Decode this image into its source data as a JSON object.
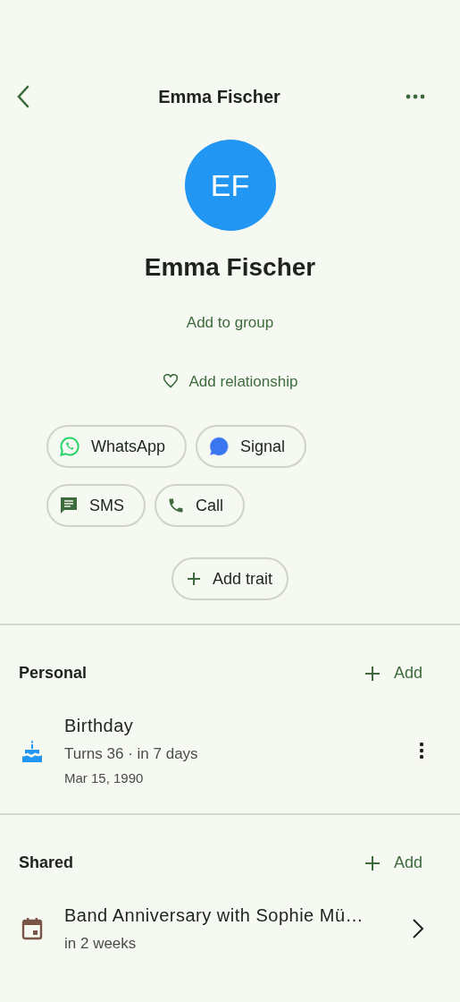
{
  "header": {
    "title": "Emma Fischer"
  },
  "contact": {
    "initials": "EF",
    "name": "Emma Fischer",
    "add_group": "Add to group",
    "add_relationship": "Add relationship"
  },
  "channels": [
    {
      "kind": "whatsapp",
      "label": "WhatsApp"
    },
    {
      "kind": "signal",
      "label": "Signal"
    },
    {
      "kind": "sms",
      "label": "SMS"
    },
    {
      "kind": "call",
      "label": "Call"
    }
  ],
  "add_trait": "Add trait",
  "sections": [
    {
      "title": "Personal",
      "add": "Add",
      "items": [
        {
          "kind": "birthday",
          "title": "Birthday",
          "subtitle": "Turns 36 · in 7 days",
          "detail": "Mar 15, 1990"
        }
      ]
    },
    {
      "title": "Shared",
      "add": "Add",
      "items": [
        {
          "kind": "event",
          "title": "Band Anniversary with Sophie Mü…",
          "subtitle": "in 2 weeks"
        }
      ]
    }
  ]
}
